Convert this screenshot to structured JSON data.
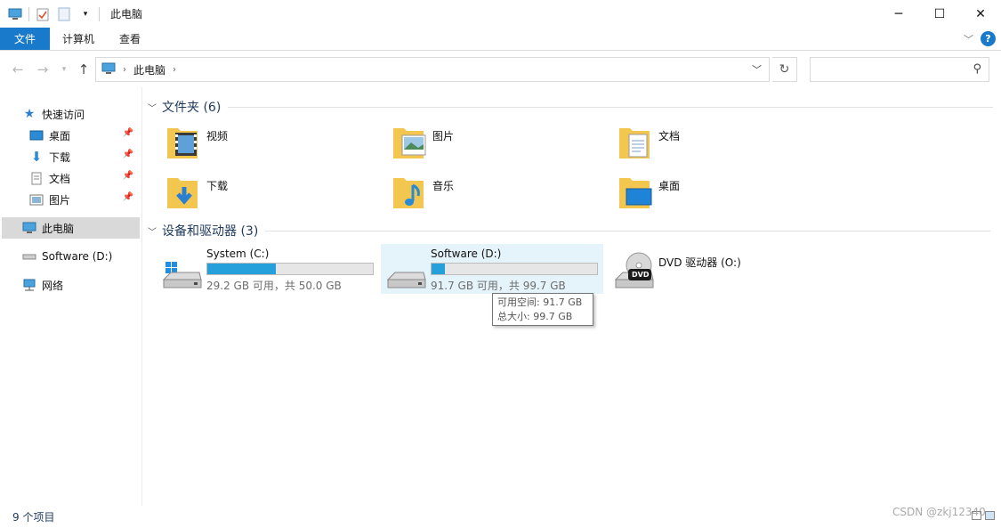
{
  "window": {
    "title": "此电脑",
    "controls": {
      "minimize": "─",
      "maximize": "☐",
      "close": "✕"
    }
  },
  "ribbon": {
    "tabs": [
      "文件",
      "计算机",
      "查看"
    ],
    "help": "?"
  },
  "address": {
    "crumb": "此电脑",
    "search_placeholder": ""
  },
  "nav": {
    "quick_access": "快速访问",
    "pinned": [
      "桌面",
      "下载",
      "文档",
      "图片"
    ],
    "this_pc": "此电脑",
    "software_drive": "Software (D:)",
    "network": "网络"
  },
  "folders": {
    "header": "文件夹 (6)",
    "items": [
      "视频",
      "图片",
      "文档",
      "下载",
      "音乐",
      "桌面"
    ]
  },
  "devices": {
    "header": "设备和驱动器 (3)",
    "drives": [
      {
        "name": "System (C:)",
        "info": "29.2 GB 可用，共 50.0 GB",
        "used_fraction": 0.416
      },
      {
        "name": "Software (D:)",
        "info": "91.7 GB 可用，共 99.7 GB",
        "used_fraction": 0.08
      }
    ],
    "dvd": "DVD 驱动器 (O:)",
    "dvd_label": "DVD"
  },
  "tooltip": {
    "free": "可用空间: 91.7 GB",
    "total": "总大小: 99.7 GB"
  },
  "status": {
    "count": "9 个项目"
  },
  "watermark": "CSDN @zkj12340",
  "colors": {
    "accent": "#1979ca",
    "bar_fill": "#26a0da",
    "group_title": "#1e395b"
  }
}
